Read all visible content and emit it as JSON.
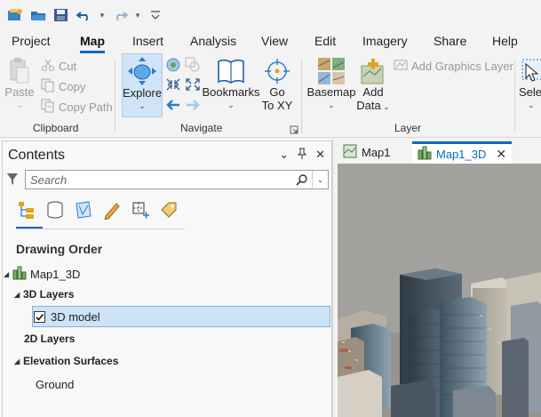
{
  "ribbon_tabs": [
    {
      "label": "Project",
      "active": false
    },
    {
      "label": "Map",
      "active": true
    },
    {
      "label": "Insert",
      "active": false
    },
    {
      "label": "Analysis",
      "active": false
    },
    {
      "label": "View",
      "active": false
    },
    {
      "label": "Edit",
      "active": false
    },
    {
      "label": "Imagery",
      "active": false
    },
    {
      "label": "Share",
      "active": false
    },
    {
      "label": "Help",
      "active": false
    }
  ],
  "clipboard": {
    "paste": "Paste",
    "cut": "Cut",
    "copy": "Copy",
    "copy_path": "Copy Path",
    "group_label": "Clipboard"
  },
  "navigate": {
    "explore": "Explore",
    "bookmarks": "Bookmarks",
    "goto_line1": "Go",
    "goto_line2": "To XY",
    "group_label": "Navigate"
  },
  "layer": {
    "basemap": "Basemap",
    "add_data_line1": "Add",
    "add_data_line2": "Data",
    "add_graphics_layer": "Add Graphics Layer",
    "group_label": "Layer",
    "select_partial": "Sele"
  },
  "contents": {
    "title": "Contents",
    "search_placeholder": "Search",
    "drawing_order": "Drawing Order",
    "map_name": "Map1_3D",
    "layers_3d": "3D Layers",
    "model_layer": "3D model",
    "model_checked": true,
    "layers_2d": "2D Layers",
    "elevation_surfaces": "Elevation Surfaces",
    "ground": "Ground"
  },
  "map_tabs": [
    {
      "label": "Map1",
      "active": false
    },
    {
      "label": "Map1_3D",
      "active": true
    }
  ],
  "colors": {
    "accent": "#0a6ac5",
    "selection": "#cde3f6"
  }
}
